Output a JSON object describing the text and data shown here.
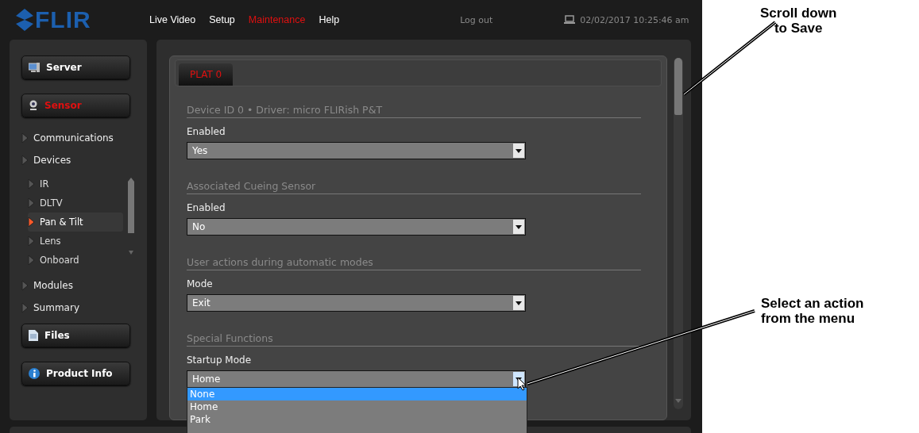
{
  "header": {
    "logo": "FLIR",
    "nav": [
      {
        "label": "Live Video",
        "selected": false
      },
      {
        "label": "Setup",
        "selected": false
      },
      {
        "label": "Maintenance",
        "selected": true
      },
      {
        "label": "Help",
        "selected": false
      }
    ],
    "logout": "Log out",
    "datetime": "02/02/2017 10:25:46 am"
  },
  "sidebar": [
    {
      "kind": "button",
      "label": "Server",
      "selected": false
    },
    {
      "kind": "button",
      "label": "Sensor",
      "selected": true
    },
    {
      "kind": "item",
      "label": "Communications",
      "selected": false
    },
    {
      "kind": "item",
      "label": "Devices",
      "selected": false,
      "children": [
        {
          "label": "IR",
          "selected": false
        },
        {
          "label": "DLTV",
          "selected": false
        },
        {
          "label": "Pan & Tilt",
          "selected": true
        },
        {
          "label": "Lens",
          "selected": false
        },
        {
          "label": "Onboard",
          "selected": false
        }
      ]
    },
    {
      "kind": "item",
      "label": "Modules",
      "selected": false
    },
    {
      "kind": "item",
      "label": "Summary",
      "selected": false
    },
    {
      "kind": "button",
      "label": "Files",
      "selected": false
    },
    {
      "kind": "button",
      "label": "Product Info",
      "selected": false
    }
  ],
  "tabs": [
    {
      "label": "PLAT 0",
      "selected": true
    }
  ],
  "sections": [
    {
      "title": "Device ID 0  •  Driver: micro FLIRish P&T",
      "fields": [
        {
          "label": "Enabled",
          "value": "Yes",
          "expanded": false
        }
      ]
    },
    {
      "title": "Associated Cueing Sensor",
      "fields": [
        {
          "label": "Enabled",
          "value": "No",
          "expanded": false
        }
      ]
    },
    {
      "title": "User actions during automatic modes",
      "fields": [
        {
          "label": "Mode",
          "value": "Exit",
          "expanded": false
        }
      ]
    },
    {
      "title": "Special Functions",
      "fields": [
        {
          "label": "Startup Mode",
          "value": "Home",
          "expanded": true,
          "options": [
            {
              "label": "None",
              "highlighted": true
            },
            {
              "label": "Home",
              "highlighted": false
            },
            {
              "label": "Park",
              "highlighted": false
            }
          ]
        }
      ]
    }
  ],
  "callouts": [
    {
      "lines": [
        "Scroll down",
        "to Save"
      ]
    },
    {
      "lines": [
        "Select an action",
        "from the menu"
      ]
    }
  ]
}
